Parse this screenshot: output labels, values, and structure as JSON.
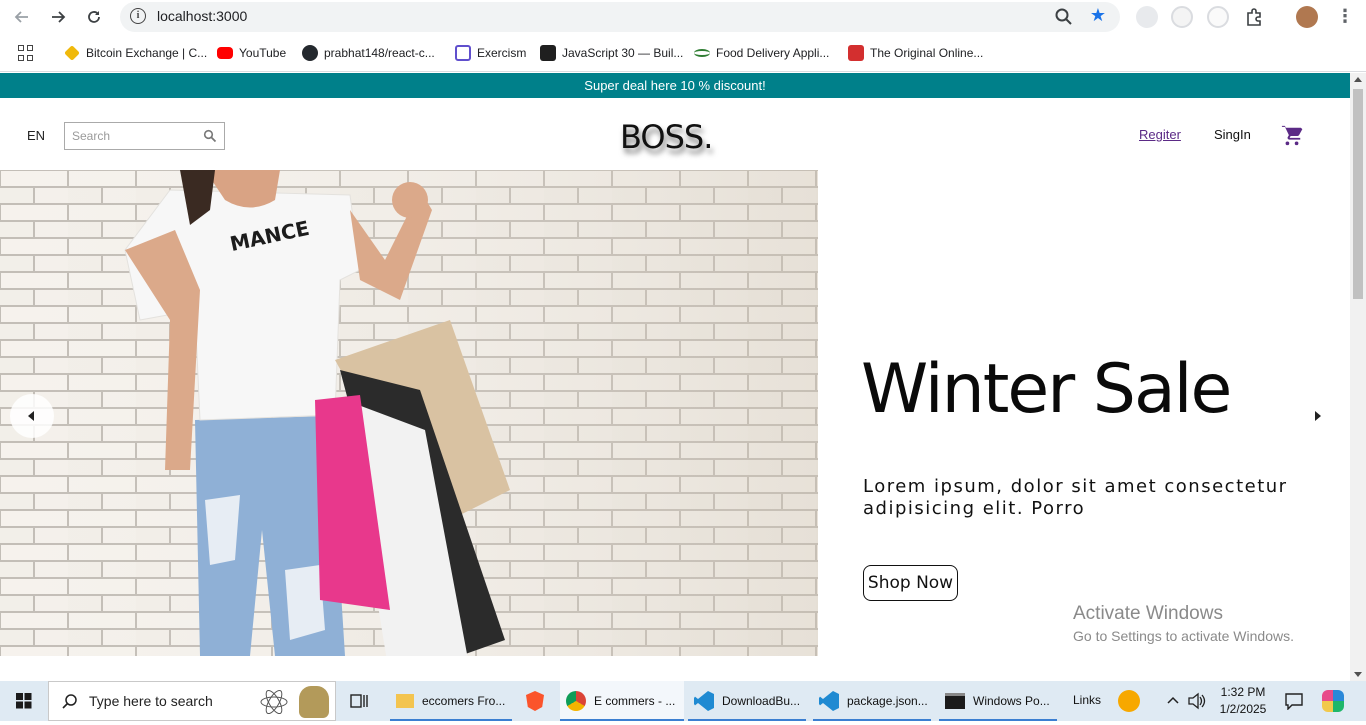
{
  "browser": {
    "url": "localhost:3000",
    "bookmarks": [
      {
        "label": "Bitcoin Exchange | C...",
        "icon": "bitcoin-icon"
      },
      {
        "label": "YouTube",
        "icon": "youtube-icon"
      },
      {
        "label": "prabhat148/react-c...",
        "icon": "github-icon"
      },
      {
        "label": "Exercism",
        "icon": "exercism-icon"
      },
      {
        "label": "JavaScript 30 — Buil...",
        "icon": "javascript30-icon"
      },
      {
        "label": "Food Delivery Appli...",
        "icon": "food-delivery-icon"
      },
      {
        "label": "The Original Online...",
        "icon": "original-online-icon"
      }
    ]
  },
  "page": {
    "announcement": "Super deal here 10 % discount!",
    "nav": {
      "language": "EN",
      "search_placeholder": "Search",
      "logo": "BOSS.",
      "register": "Regiter",
      "signin": "SingIn"
    },
    "hero": {
      "title": "Winter Sale",
      "description": "Lorem ipsum, dolor sit amet consectetur adipisicing elit. Porro",
      "button": "Shop Now"
    },
    "watermark": {
      "title": "Activate Windows",
      "subtitle": "Go to Settings to activate Windows."
    }
  },
  "taskbar": {
    "search_placeholder": "Type here to search",
    "apps": [
      {
        "label": "eccomers Fro...",
        "icon": "folder-icon"
      },
      {
        "label": "E commers - ...",
        "icon": "chrome-icon"
      },
      {
        "label": "DownloadBu...",
        "icon": "vscode-icon"
      },
      {
        "label": "package.json...",
        "icon": "vscode-icon"
      },
      {
        "label": "Windows Po...",
        "icon": "terminal-icon"
      }
    ],
    "links": "Links",
    "time": "1:32 PM",
    "date": "1/2/2025"
  },
  "colors": {
    "announcement_bg": "#00808a",
    "cart": "#5b2a86",
    "taskbar_bg": "#dfeaf3"
  }
}
